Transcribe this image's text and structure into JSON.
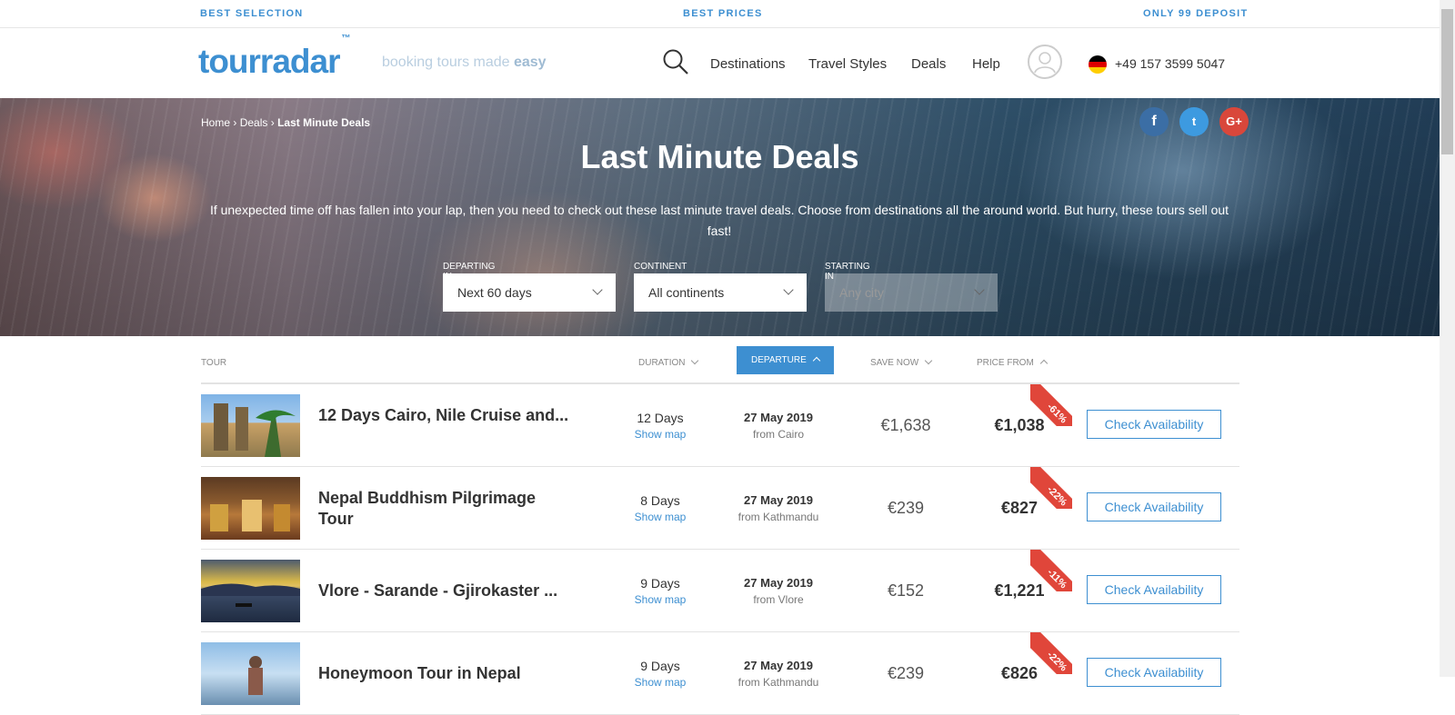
{
  "topbar": {
    "left": "BEST SELECTION",
    "center": "BEST PRICES",
    "right": "ONLY 99 DEPOSIT"
  },
  "header": {
    "logo": "tourradar",
    "logo_tm": "™",
    "tagline_prefix": "booking tours made ",
    "tagline_bold": "easy",
    "nav": [
      "Destinations",
      "Travel Styles",
      "Deals",
      "Help"
    ],
    "phone": "+49 157 3599 5047"
  },
  "hero": {
    "breadcrumb": [
      "Home",
      "Deals",
      "Last Minute Deals"
    ],
    "social": [
      "f",
      "t",
      "G+"
    ],
    "title": "Last Minute Deals",
    "description": "If unexpected time off has fallen into your lap, then you need to check out these last minute travel deals. Choose from destinations all the around world. But hurry, these tours sell out fast!",
    "filters": [
      {
        "label": "DEPARTING IN",
        "value": "Next 60 days"
      },
      {
        "label": "CONTINENT",
        "value": "All continents"
      },
      {
        "label": "STARTING IN",
        "value": "Any city"
      }
    ]
  },
  "table": {
    "headers": {
      "tour": "TOUR",
      "duration": "DURATION",
      "departure": "DEPARTURE",
      "save": "SAVE NOW",
      "price": "PRICE FROM"
    },
    "rows": [
      {
        "title": "12 Days Cairo, Nile Cruise and...",
        "duration": "12 Days",
        "map": "Show map",
        "date": "27 May 2019",
        "from": "from Cairo",
        "save": "€1,638",
        "price": "€1,038",
        "discount": "-61%",
        "button": "Check Availability"
      },
      {
        "title": "Nepal Buddhism Pilgrimage Tour",
        "duration": "8 Days",
        "map": "Show map",
        "date": "27 May 2019",
        "from": "from Kathmandu",
        "save": "€239",
        "price": "€827",
        "discount": "-22%",
        "button": "Check Availability"
      },
      {
        "title": "Vlore - Sarande - Gjirokaster ...",
        "duration": "9 Days",
        "map": "Show map",
        "date": "27 May 2019",
        "from": "from Vlore",
        "save": "€152",
        "price": "€1,221",
        "discount": "-11%",
        "button": "Check Availability"
      },
      {
        "title": "Honeymoon Tour in Nepal",
        "duration": "9 Days",
        "map": "Show map",
        "date": "27 May 2019",
        "from": "from Kathmandu",
        "save": "€239",
        "price": "€826",
        "discount": "-22%",
        "button": "Check Availability"
      }
    ]
  },
  "colors": {
    "brand": "#3d8fd1",
    "discount": "#e0463a"
  }
}
